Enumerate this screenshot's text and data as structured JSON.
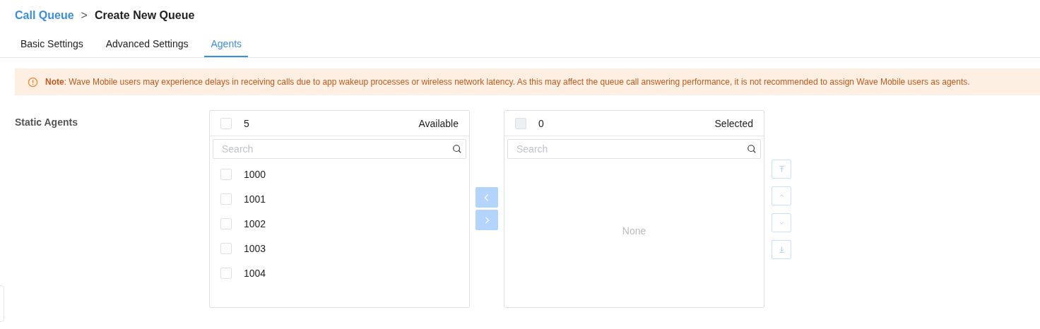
{
  "breadcrumb": {
    "parent": "Call Queue",
    "separator": ">",
    "current": "Create New Queue"
  },
  "tabs": [
    {
      "label": "Basic Settings",
      "selected": false
    },
    {
      "label": "Advanced Settings",
      "selected": false
    },
    {
      "label": "Agents",
      "selected": true
    }
  ],
  "note": {
    "text": "**Note**: Wave Mobile users may experience delays in receiving calls due to app wakeup processes or wireless network latency. As this may affect the queue call answering performance, it is not recommended to assign Wave Mobile users as agents."
  },
  "static_agents": {
    "label": "Static Agents",
    "available": {
      "count": "5",
      "title": "Available",
      "checked": false,
      "disabled": false,
      "search": {
        "placeholder": "Search"
      },
      "items": [
        {
          "label": "1000",
          "checked": false
        },
        {
          "label": "1001",
          "checked": false
        },
        {
          "label": "1002",
          "checked": false
        },
        {
          "label": "1003",
          "checked": false
        },
        {
          "label": "1004",
          "checked": false
        }
      ]
    },
    "transfer_buttons": [
      {
        "kind": "left",
        "disabled": true
      },
      {
        "kind": "right",
        "disabled": true
      }
    ],
    "selected": {
      "count": "0",
      "title": "Selected",
      "checked": false,
      "disabled": true,
      "search": {
        "placeholder": "Search"
      },
      "empty_text": "None"
    },
    "order_buttons": [
      {
        "kind": "top",
        "disabled": true
      },
      {
        "kind": "up",
        "disabled": true
      },
      {
        "kind": "down",
        "disabled": true
      },
      {
        "kind": "bottom",
        "disabled": true
      }
    ]
  }
}
